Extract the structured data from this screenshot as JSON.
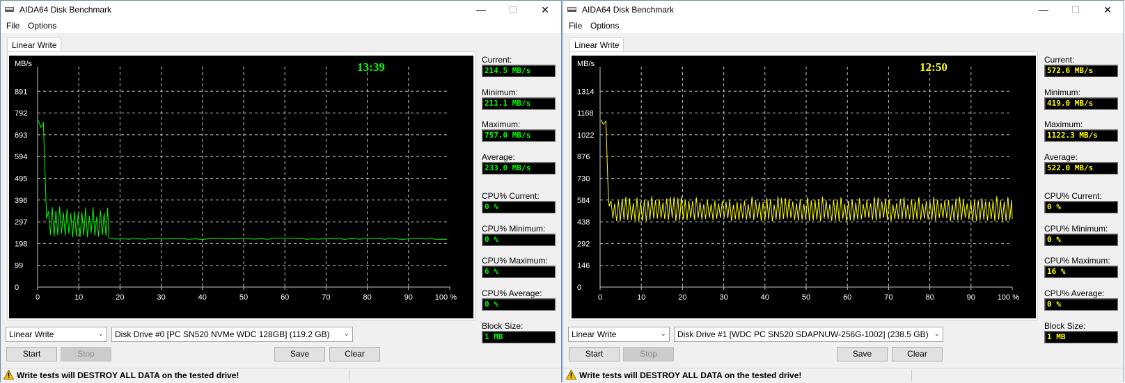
{
  "windows": [
    {
      "id": "left",
      "title": "AIDA64 Disk Benchmark",
      "menu": [
        "File",
        "Options"
      ],
      "tab": "Linear Write",
      "timer": "13:39",
      "accent": "#00ff00",
      "stats": [
        {
          "label": "Current:",
          "value": "214.5 MB/s"
        },
        {
          "label": "Minimum:",
          "value": "211.1 MB/s"
        },
        {
          "label": "Maximum:",
          "value": "757.0 MB/s"
        },
        {
          "label": "Average:",
          "value": "233.0 MB/s"
        },
        {
          "label": "CPU% Current:",
          "value": "0 %"
        },
        {
          "label": "CPU% Minimum:",
          "value": "0 %"
        },
        {
          "label": "CPU% Maximum:",
          "value": "6 %"
        },
        {
          "label": "CPU% Average:",
          "value": "0 %"
        },
        {
          "label": "Block Size:",
          "value": "1 MB"
        }
      ],
      "test_select": "Linear Write",
      "drive_select": "Disk Drive #0  [PC SN520 NVMe WDC 128GB]  (119.2 GB)",
      "buttons": {
        "start": "Start",
        "stop": "Stop",
        "save": "Save",
        "clear": "Clear"
      },
      "warning": "Write tests will DESTROY ALL DATA on the tested drive!",
      "chart_data": {
        "type": "line",
        "ylabel": "MB/s",
        "y_ticks": [
          "891",
          "792",
          "693",
          "594",
          "495",
          "396",
          "297",
          "198",
          "99",
          "0"
        ],
        "x_ticks": [
          "0",
          "10",
          "20",
          "30",
          "40",
          "50",
          "60",
          "70",
          "80",
          "90",
          "100 %"
        ],
        "ylim": [
          0,
          990
        ],
        "xlim": [
          0,
          100
        ],
        "series": [
          {
            "color": "#00ff00",
            "profile": {
              "start": 757,
              "spike_end": 2,
              "fluct_start": 2.2,
              "fluct_end": 17,
              "fluct_low": 225,
              "fluct_high": 370,
              "steady": 220,
              "steady_jitter": 6
            }
          }
        ]
      }
    },
    {
      "id": "right",
      "title": "AIDA64 Disk Benchmark",
      "menu": [
        "File",
        "Options"
      ],
      "tab": "Linear Write",
      "timer": "12:50",
      "accent": "#ffff00",
      "stats": [
        {
          "label": "Current:",
          "value": "572.6 MB/s"
        },
        {
          "label": "Minimum:",
          "value": "419.0 MB/s"
        },
        {
          "label": "Maximum:",
          "value": "1122.3 MB/s"
        },
        {
          "label": "Average:",
          "value": "522.0 MB/s"
        },
        {
          "label": "CPU% Current:",
          "value": "0 %"
        },
        {
          "label": "CPU% Minimum:",
          "value": "0 %"
        },
        {
          "label": "CPU% Maximum:",
          "value": "16 %"
        },
        {
          "label": "CPU% Average:",
          "value": "0 %"
        },
        {
          "label": "Block Size:",
          "value": "1 MB"
        }
      ],
      "test_select": "Linear Write",
      "drive_select": "Disk Drive #1  [WDC PC SN520 SDAPNUW-256G-1002]  (238.5 GB)",
      "buttons": {
        "start": "Start",
        "stop": "Stop",
        "save": "Save",
        "clear": "Clear"
      },
      "warning": "Write tests will DESTROY ALL DATA on the tested drive!",
      "chart_data": {
        "type": "line",
        "ylabel": "MB/s",
        "y_ticks": [
          "1314",
          "1168",
          "1022",
          "876",
          "730",
          "584",
          "438",
          "292",
          "146",
          "0"
        ],
        "x_ticks": [
          "0",
          "10",
          "20",
          "30",
          "40",
          "50",
          "60",
          "70",
          "80",
          "90",
          "100 %"
        ],
        "ylim": [
          0,
          1460
        ],
        "xlim": [
          0,
          100
        ],
        "series": [
          {
            "color": "#ffff00",
            "profile": {
              "start": 1122,
              "spike_end": 2,
              "fluct_start": 2.2,
              "fluct_end": 100,
              "fluct_low": 440,
              "fluct_high": 610,
              "steady": 520,
              "steady_jitter": 0
            }
          }
        ]
      }
    }
  ]
}
